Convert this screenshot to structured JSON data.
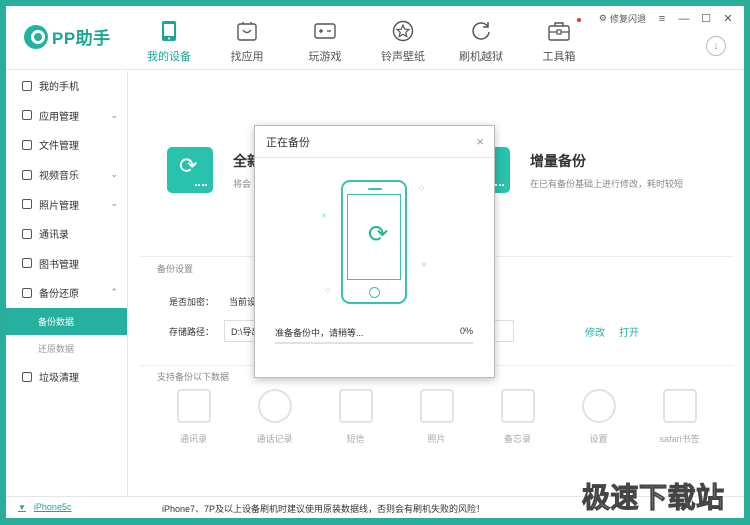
{
  "app": {
    "name": "PP助手"
  },
  "top_nav": [
    {
      "label": "我的设备",
      "icon": "phone-icon",
      "active": true
    },
    {
      "label": "找应用",
      "icon": "app-store-icon",
      "active": false
    },
    {
      "label": "玩游戏",
      "icon": "gamepad-icon",
      "active": false
    },
    {
      "label": "铃声壁纸",
      "icon": "star-icon",
      "active": false
    },
    {
      "label": "刷机越狱",
      "icon": "refresh-icon",
      "active": false
    },
    {
      "label": "工具箱",
      "icon": "toolbox-icon",
      "active": false,
      "badge_dot": true
    }
  ],
  "window_controls": {
    "repair_label": "修复闪退",
    "minimize": "—",
    "maximize": "☐",
    "close": "✕",
    "menu": "≡"
  },
  "sidebar": {
    "items": [
      {
        "label": "我的手机",
        "chevron": false
      },
      {
        "label": "应用管理",
        "chevron": true
      },
      {
        "label": "文件管理",
        "chevron": false
      },
      {
        "label": "视频音乐",
        "chevron": true
      },
      {
        "label": "照片管理",
        "chevron": true
      },
      {
        "label": "通讯录",
        "chevron": false
      },
      {
        "label": "图书管理",
        "chevron": false
      },
      {
        "label": "备份还原",
        "chevron": true
      }
    ],
    "sub_items": [
      {
        "label": "备份数据",
        "active": true
      },
      {
        "label": "还原数据",
        "active": false
      }
    ],
    "last_item": {
      "label": "垃圾清理"
    }
  },
  "main": {
    "full_backup": {
      "title": "全新",
      "desc": "将会"
    },
    "incremental_backup": {
      "title": "增量备份",
      "desc": "在已有备份基础上进行修改，耗时较短"
    },
    "settings_title": "备份设置",
    "encrypt_label": "是否加密：",
    "encrypt_value": "当前设",
    "path_label": "存储路径：",
    "path_value": "D:\\导出",
    "modify_link": "修改",
    "open_link": "打开",
    "supported_title": "支持备份以下数据",
    "data_types": [
      "通讯录",
      "通话记录",
      "短信",
      "照片",
      "备忘录",
      "设置",
      "safari书签"
    ]
  },
  "dialog": {
    "title": "正在备份",
    "close": "×",
    "status_text": "准备备份中，请稍等...",
    "percent_text": "0%",
    "progress": 0
  },
  "statusbar": {
    "device": "iPhone5c",
    "notice": "iPhone7、7P及以上设备刷机时建议使用原装数据线，否则会有刷机失败的风险！"
  },
  "watermark": "极速下载站",
  "colors": {
    "accent": "#25b09f",
    "frame": "#2aae9b"
  }
}
